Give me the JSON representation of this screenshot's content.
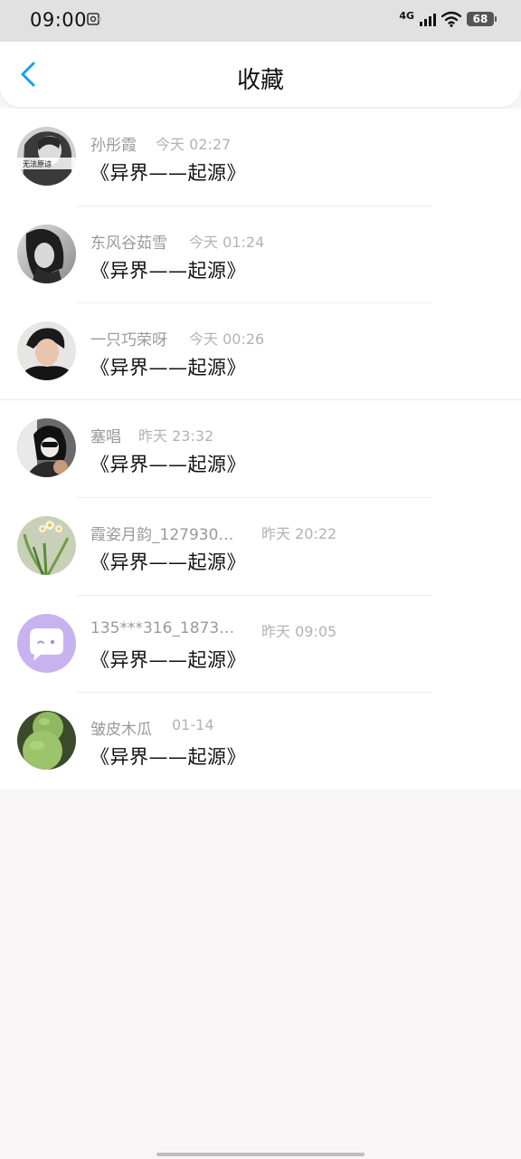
{
  "status": {
    "time": "09:00",
    "network": "4G",
    "battery": "68"
  },
  "header": {
    "title": "收藏",
    "back_icon": "chevron-left-icon"
  },
  "favorites": [
    {
      "user": "孙彤霞",
      "time": "今天 02:27",
      "book": "《异界——起源》",
      "avatar_badge": "无法原谅"
    },
    {
      "user": "东风谷茹雪",
      "time": "今天 01:24",
      "book": "《异界——起源》"
    },
    {
      "user": "一只巧荣呀",
      "time": "今天 00:26",
      "book": "《异界——起源》"
    },
    {
      "user": "塞唱",
      "time": "昨天 23:32",
      "book": "《异界——起源》"
    },
    {
      "user": "霞姿月韵_127930…",
      "time": "昨天 20:22",
      "book": "《异界——起源》"
    },
    {
      "user": "135***316_1873…",
      "time": "昨天 09:05",
      "book": "《异界——起源》"
    },
    {
      "user": "皱皮木瓜",
      "time": "01-14",
      "book": "《异界——起源》"
    }
  ],
  "colors": {
    "accent": "#1aa0e6",
    "avatar_placeholder": "#c9b2f0"
  }
}
